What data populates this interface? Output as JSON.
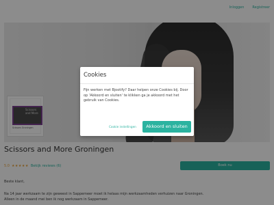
{
  "topbar": {
    "login": "Inloggen",
    "register": "Registreer"
  },
  "logo": {
    "text": "Scissors and More",
    "sub": "Scissors Groningen"
  },
  "salon": {
    "name": "Scissors and More Groningen",
    "score": "5.0",
    "stars": "★★★★★",
    "reviews": "Bekijk reviews (6)",
    "book": "Boek nu"
  },
  "content": {
    "greeting": "Beste klant,",
    "line1": "Na 14 jaar werkzaam te zijn geweest in Sappemeer moet ik helaas mijn werkzaamheden verhuizen naar Groningen.",
    "line2": "Alleen in de maand mei ben ik nog werkzaam in Sappemeer."
  },
  "cookie_modal": {
    "title": "Cookies",
    "text": "Fijn werken met Bjootify? Daar helpen onze Cookies bij. Door op 'Akkoord en sluiten' te klikken ga je akkoord met het gebruik van Cookies.",
    "settings": "Cookie instellingen",
    "accept": "Akkoord en sluiten"
  },
  "colors": {
    "accent": "#2bb3a0",
    "star": "#e8a13a"
  }
}
